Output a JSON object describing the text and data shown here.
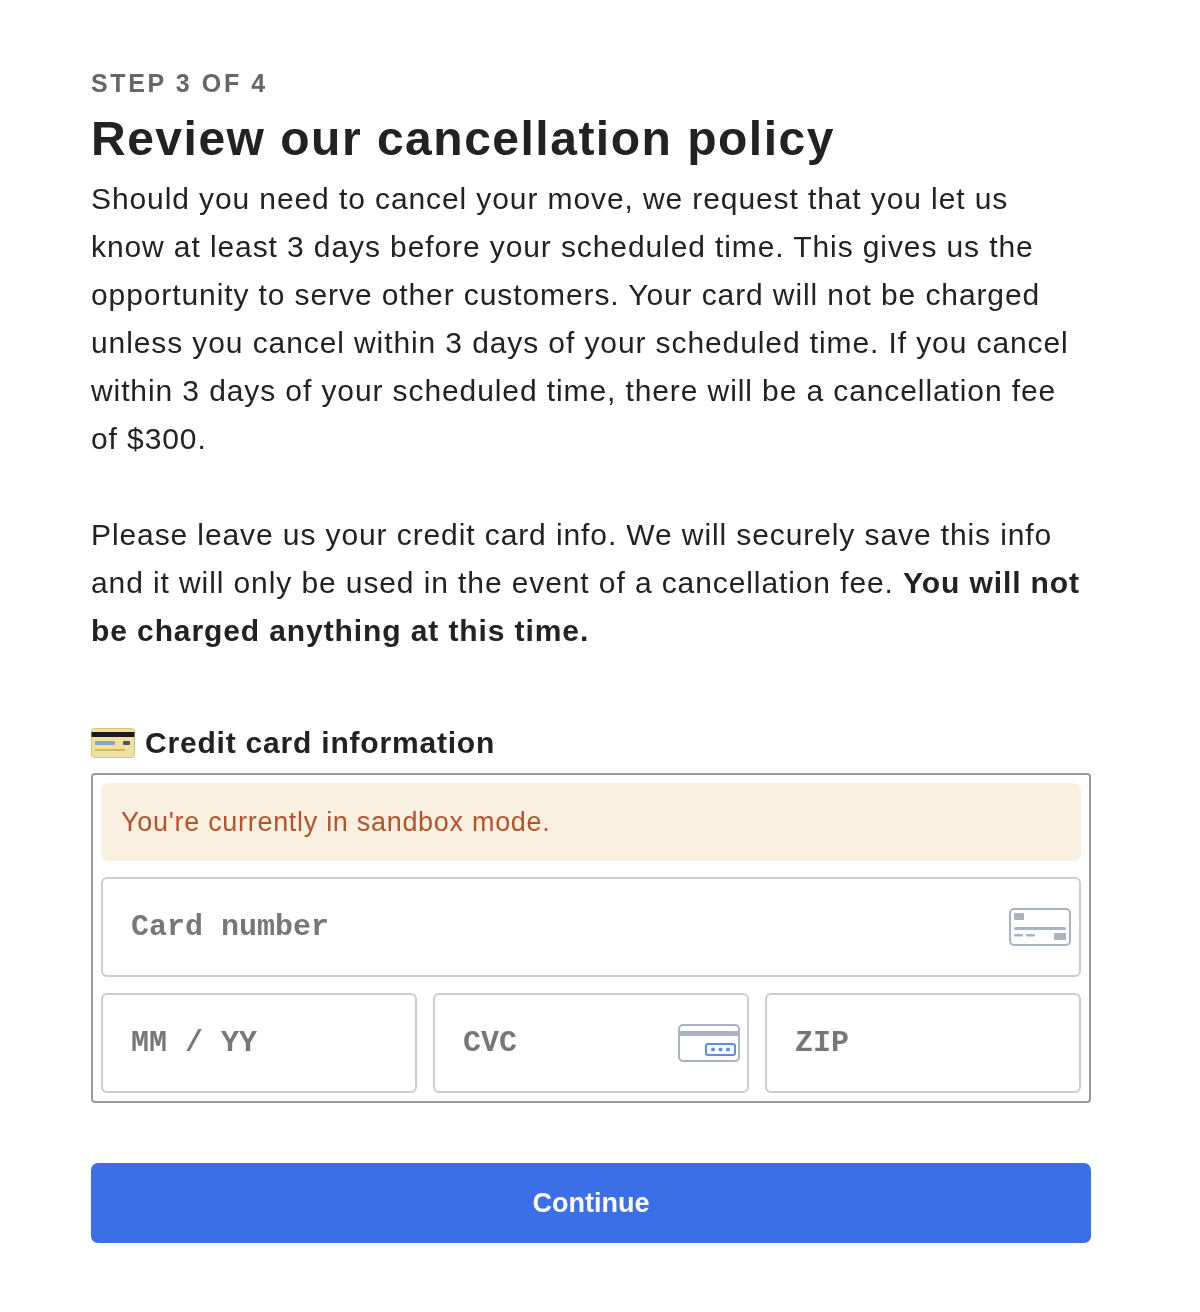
{
  "step_label": "STEP 3 OF 4",
  "title": "Review our cancellation policy",
  "paragraphs": [
    "Should you need to cancel your move, we request that you let us know at least 3 days before your scheduled time. This gives us the opportunity to serve other customers. Your card will not be charged unless you cancel within 3 days of your scheduled time. If you cancel within 3 days of your scheduled time, there will be a cancellation fee of $300.",
    "Please leave us your credit card info. We will securely save this info and it will only be used in the event of a cancellation fee. **You will not be charged anything at this time.**"
  ],
  "card_section": {
    "heading": "Credit card information",
    "notice": "You're currently in sandbox mode.",
    "fields": [
      {
        "kind": "card_number",
        "placeholder": "Card number"
      },
      {
        "kind": "expiry",
        "placeholder": "MM / YY"
      },
      {
        "kind": "cvc",
        "placeholder": "CVC"
      },
      {
        "kind": "zip",
        "placeholder": "ZIP"
      }
    ]
  },
  "button": "Continue"
}
